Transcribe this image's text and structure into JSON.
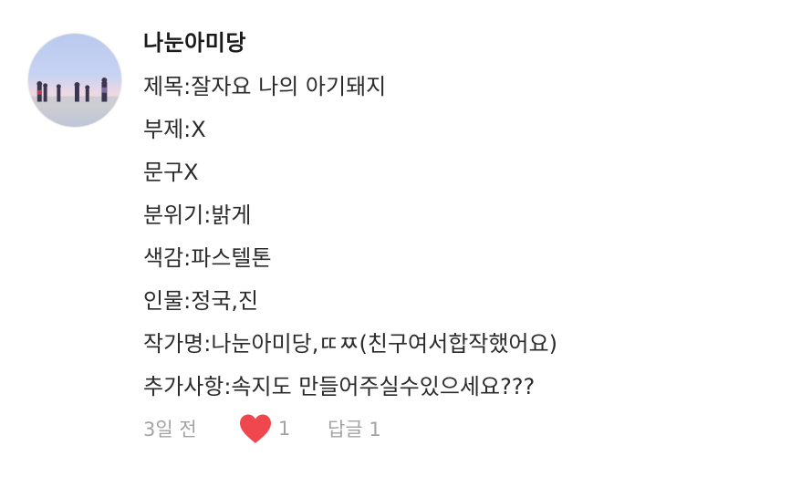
{
  "comment": {
    "author": "나눈아미당",
    "avatar_icon": "profile-photo-avatar",
    "lines": [
      "제목:잘자요 나의 아기돼지",
      "부제:X",
      "문구X",
      "분위기:밝게",
      "색감:파스텔톤",
      "인물:정국,진",
      "작가명:나눈아미당,ㄸㅉ(친구여서합작했어요)",
      "추가사항:속지도 만들어주실수있으세요???"
    ],
    "time": "3일 전",
    "like_icon": "heart-icon",
    "like_color": "#f0474f",
    "like_count": "1",
    "reply_label": "답글 1"
  }
}
